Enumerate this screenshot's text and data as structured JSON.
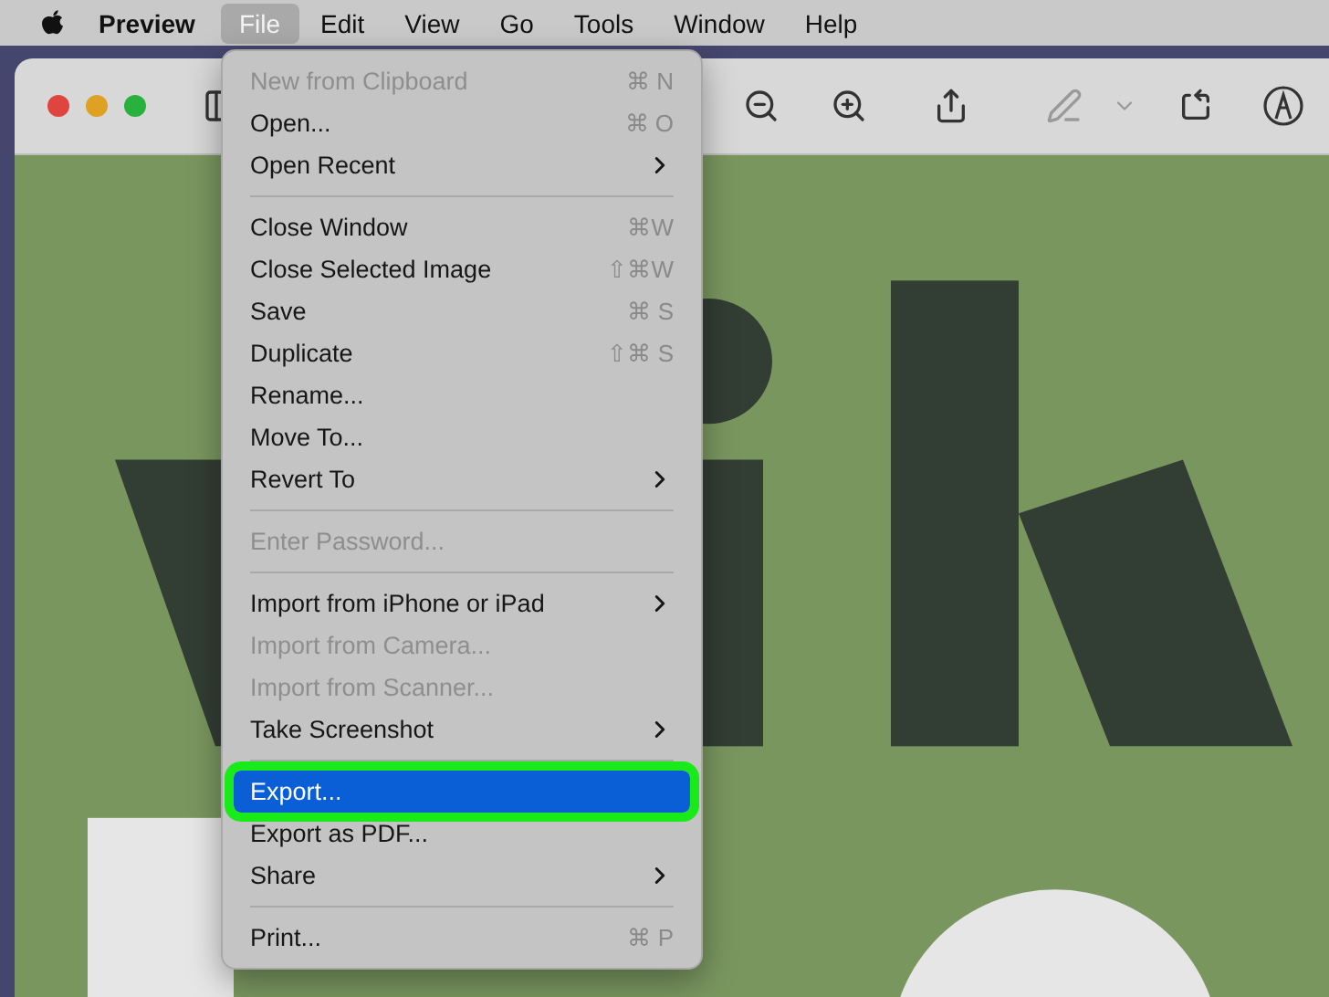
{
  "menu_bar": {
    "app_name": "Preview",
    "menus": [
      {
        "label": "File",
        "selected": true
      },
      {
        "label": "Edit",
        "selected": false
      },
      {
        "label": "View",
        "selected": false
      },
      {
        "label": "Go",
        "selected": false
      },
      {
        "label": "Tools",
        "selected": false
      },
      {
        "label": "Window",
        "selected": false
      },
      {
        "label": "Help",
        "selected": false
      }
    ]
  },
  "file_menu": {
    "items": [
      {
        "kind": "item",
        "label": "New from Clipboard",
        "shortcut": "⌘ N",
        "disabled": true,
        "submenu": false,
        "selected": false
      },
      {
        "kind": "item",
        "label": "Open...",
        "shortcut": "⌘ O",
        "disabled": false,
        "submenu": false,
        "selected": false
      },
      {
        "kind": "item",
        "label": "Open Recent",
        "disabled": false,
        "submenu": true,
        "selected": false
      },
      {
        "kind": "separator"
      },
      {
        "kind": "item",
        "label": "Close Window",
        "shortcut": "⌘W",
        "disabled": false,
        "submenu": false,
        "selected": false
      },
      {
        "kind": "item",
        "label": "Close Selected Image",
        "shortcut": "⇧⌘W",
        "disabled": false,
        "submenu": false,
        "selected": false
      },
      {
        "kind": "item",
        "label": "Save",
        "shortcut": "⌘ S",
        "disabled": false,
        "submenu": false,
        "selected": false
      },
      {
        "kind": "item",
        "label": "Duplicate",
        "shortcut": "⇧⌘ S",
        "disabled": false,
        "submenu": false,
        "selected": false
      },
      {
        "kind": "item",
        "label": "Rename...",
        "disabled": false,
        "submenu": false,
        "selected": false
      },
      {
        "kind": "item",
        "label": "Move To...",
        "disabled": false,
        "submenu": false,
        "selected": false
      },
      {
        "kind": "item",
        "label": "Revert To",
        "disabled": false,
        "submenu": true,
        "selected": false
      },
      {
        "kind": "separator"
      },
      {
        "kind": "item",
        "label": "Enter Password...",
        "disabled": true,
        "submenu": false,
        "selected": false
      },
      {
        "kind": "separator"
      },
      {
        "kind": "item",
        "label": "Import from iPhone or iPad",
        "disabled": false,
        "submenu": true,
        "selected": false
      },
      {
        "kind": "item",
        "label": "Import from Camera...",
        "disabled": true,
        "submenu": false,
        "selected": false
      },
      {
        "kind": "item",
        "label": "Import from Scanner...",
        "disabled": true,
        "submenu": false,
        "selected": false
      },
      {
        "kind": "item",
        "label": "Take Screenshot",
        "disabled": false,
        "submenu": true,
        "selected": false
      },
      {
        "kind": "separator"
      },
      {
        "kind": "item",
        "label": "Export...",
        "disabled": false,
        "submenu": false,
        "selected": true,
        "callout": true
      },
      {
        "kind": "item",
        "label": "Export as PDF...",
        "disabled": false,
        "submenu": false,
        "selected": false
      },
      {
        "kind": "item",
        "label": "Share",
        "disabled": false,
        "submenu": true,
        "selected": false
      },
      {
        "kind": "separator"
      },
      {
        "kind": "item",
        "label": "Print...",
        "shortcut": "⌘ P",
        "disabled": false,
        "submenu": false,
        "selected": false
      }
    ]
  }
}
